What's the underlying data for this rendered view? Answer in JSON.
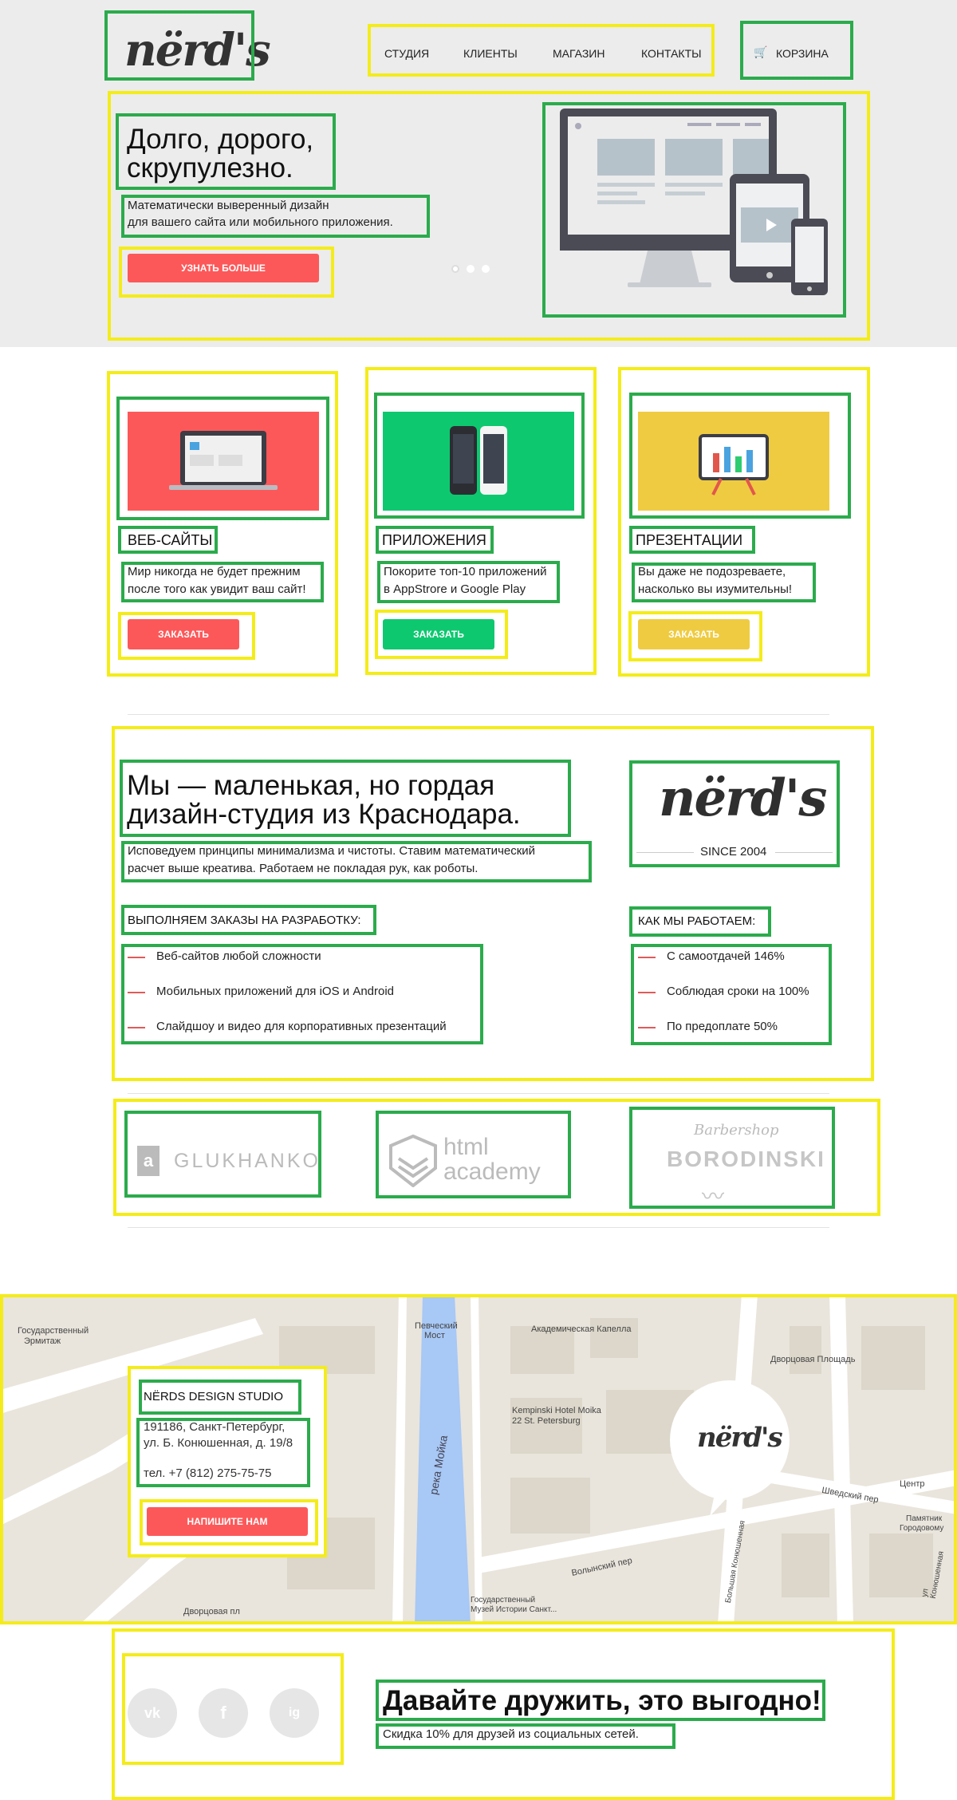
{
  "header": {
    "logo": "nërd's",
    "nav": [
      "Студия",
      "Клиенты",
      "Магазин",
      "Контакты"
    ],
    "cart_label": "Корзина"
  },
  "hero": {
    "title_line1": "Долго, дорого,",
    "title_line2": "скрупулезно.",
    "desc_line1": "Математически выверенный дизайн",
    "desc_line2": "для вашего сайта или мобильного приложения.",
    "button": "Узнать больше",
    "slides_count": 3,
    "active_slide": 1
  },
  "services": [
    {
      "title": "Веб-сайты",
      "line1": "Мир никогда не будет прежним",
      "line2": "после того как увидит ваш сайт!",
      "button": "Заказать",
      "color": "#fd5859"
    },
    {
      "title": "Приложения",
      "line1": "Покорите топ-10 приложений",
      "line2": "в AppStrore и Google Play",
      "button": "Заказать",
      "color": "#0ec870"
    },
    {
      "title": "Презентации",
      "line1": "Вы даже не подозреваете,",
      "line2": "насколько вы изумительны!",
      "button": "Заказать",
      "color": "#efcb41"
    }
  ],
  "about": {
    "title_line1": "Мы — маленькая, но гордая",
    "title_line2": "дизайн-студия из Краснодара.",
    "desc_line1": "Исповедуем принципы минимализма и чистоты. Ставим математический",
    "desc_line2": "расчет выше креатива. Работаем не покладая рук, как роботы.",
    "logo": "nërd's",
    "since": "SINCE 2004",
    "orders_title": "Выполняем заказы на разработку:",
    "orders": [
      "Веб-сайтов любой сложности",
      "Мобильных приложений для iOS и Android",
      "Слайдшоу и видео для корпоративных презентаций"
    ],
    "how_title": "Как мы работаем:",
    "how": [
      "С самоотдачей 146%",
      "Соблюдая сроки на 100%",
      "По предоплате 50%"
    ]
  },
  "partners": {
    "glukhanko": "GLUKHANKO",
    "academy_line1": "html",
    "academy_line2": "academy",
    "barbershop": "Barbershop",
    "borodinski": "BORODINSKI"
  },
  "map": {
    "labels": {
      "ermitazh1": "Государственный",
      "ermitazh2": "Эрмитаж",
      "pevchesky1": "Певческий",
      "pevchesky2": "Мост",
      "kapella": "Академическая Капелла",
      "dvortsovaya": "Дворцовая Площадь",
      "kempinski1": "Kempinski Hotel Moika",
      "kempinski2": "22 St. Petersburg",
      "moika": "река Мойка",
      "volynsky": "Волынский пер",
      "shvedsky": "Шведский пер",
      "tsentr": "Центр",
      "pamyatnik1": "Памятник",
      "pamyatnik2": "Городовому",
      "muzey1": "Государственный",
      "muzey2": "Музей Истории Санкт...",
      "dvortsovaya_pl": "Дворцовая пл",
      "konushennaya": "ул Конюшенная",
      "bolshaya": "Большая Конюшенная"
    },
    "card_title": "NËRDS DESIGN STUDIO",
    "address_line1": "191186, Санкт-Петербург,",
    "address_line2": "ул. Б. Конюшенная, д. 19/8",
    "phone": "тел. +7 (812) 275-75-75",
    "button": "Напишите нам",
    "bubble_logo": "nërd's"
  },
  "footer": {
    "social": [
      "vk",
      "f",
      "ig"
    ],
    "title": "Давайте дружить, это выгодно!",
    "subtitle": "Скидка 10% для друзей из социальных сетей."
  }
}
